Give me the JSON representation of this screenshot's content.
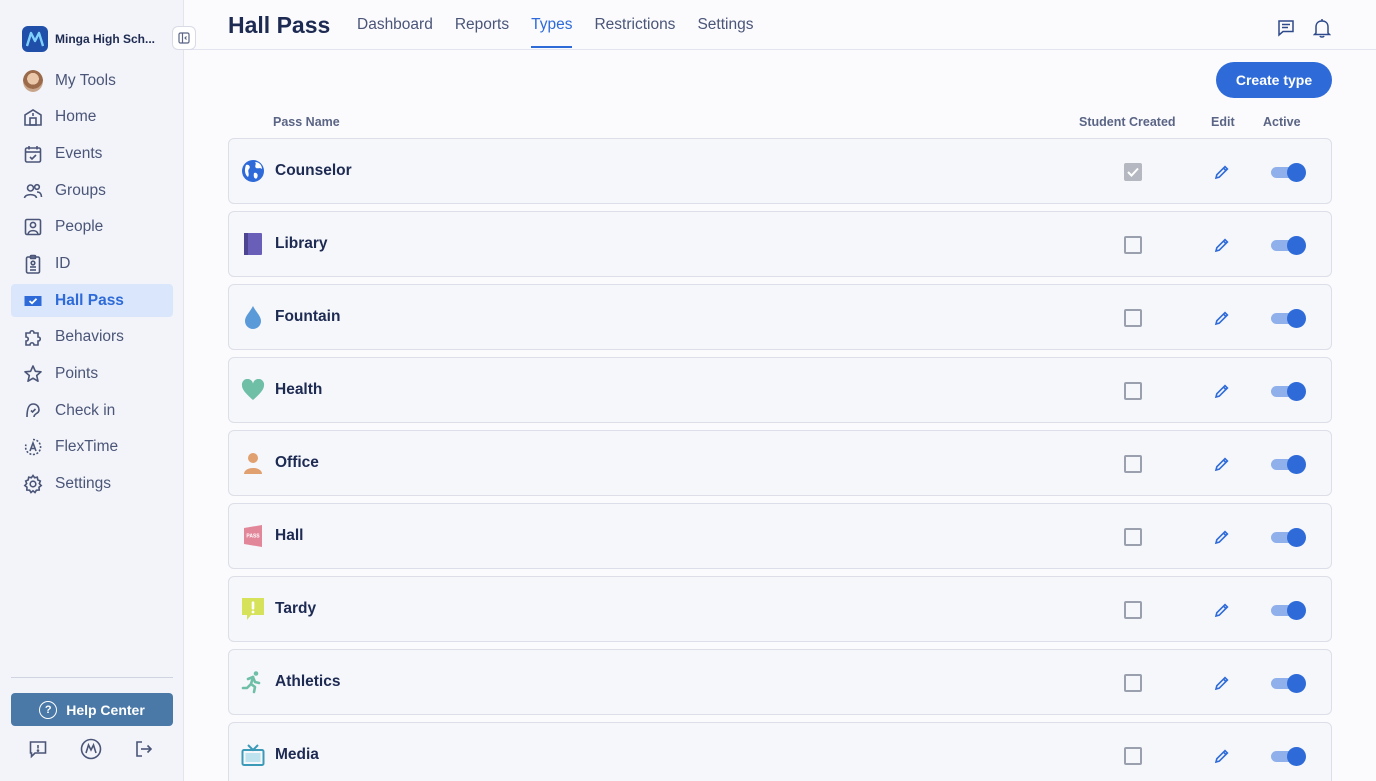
{
  "brand": {
    "name": "Minga High Sch..."
  },
  "sidebar": {
    "items": [
      {
        "label": "My Tools",
        "icon": "avatar"
      },
      {
        "label": "Home",
        "icon": "home-icon"
      },
      {
        "label": "Events",
        "icon": "calendar-icon"
      },
      {
        "label": "Groups",
        "icon": "groups-icon"
      },
      {
        "label": "People",
        "icon": "people-icon"
      },
      {
        "label": "ID",
        "icon": "id-icon"
      },
      {
        "label": "Hall Pass",
        "icon": "hall-pass-icon",
        "active": true
      },
      {
        "label": "Behaviors",
        "icon": "puzzle-icon"
      },
      {
        "label": "Points",
        "icon": "star-icon"
      },
      {
        "label": "Check in",
        "icon": "check-in-icon"
      },
      {
        "label": "FlexTime",
        "icon": "flextime-icon"
      },
      {
        "label": "Settings",
        "icon": "gear-icon"
      }
    ],
    "help_label": "Help Center"
  },
  "header": {
    "title": "Hall Pass",
    "tabs": [
      {
        "label": "Dashboard"
      },
      {
        "label": "Reports"
      },
      {
        "label": "Types",
        "active": true
      },
      {
        "label": "Restrictions"
      },
      {
        "label": "Settings"
      }
    ]
  },
  "main": {
    "create_label": "Create type",
    "columns": {
      "name": "Pass Name",
      "student_created": "Student Created",
      "edit": "Edit",
      "active": "Active"
    },
    "rows": [
      {
        "name": "Counselor",
        "icon": "globe-icon",
        "student_created": true,
        "active": true
      },
      {
        "name": "Library",
        "icon": "book-icon",
        "student_created": false,
        "active": true
      },
      {
        "name": "Fountain",
        "icon": "water-drop-icon",
        "student_created": false,
        "active": true
      },
      {
        "name": "Health",
        "icon": "heart-icon",
        "student_created": false,
        "active": true
      },
      {
        "name": "Office",
        "icon": "person-icon",
        "student_created": false,
        "active": true
      },
      {
        "name": "Hall",
        "icon": "pass-flag-icon",
        "icon_text": "PASS",
        "student_created": false,
        "active": true
      },
      {
        "name": "Tardy",
        "icon": "alert-bubble-icon",
        "student_created": false,
        "active": true
      },
      {
        "name": "Athletics",
        "icon": "runner-icon",
        "student_created": false,
        "active": true
      },
      {
        "name": "Media",
        "icon": "tv-icon",
        "student_created": false,
        "active": true
      }
    ]
  },
  "colors": {
    "accent": "#2e6bd9",
    "nav_active_bg": "#d9e6fb",
    "help_button": "#4a79a8",
    "text_dark": "#1d2a52"
  }
}
